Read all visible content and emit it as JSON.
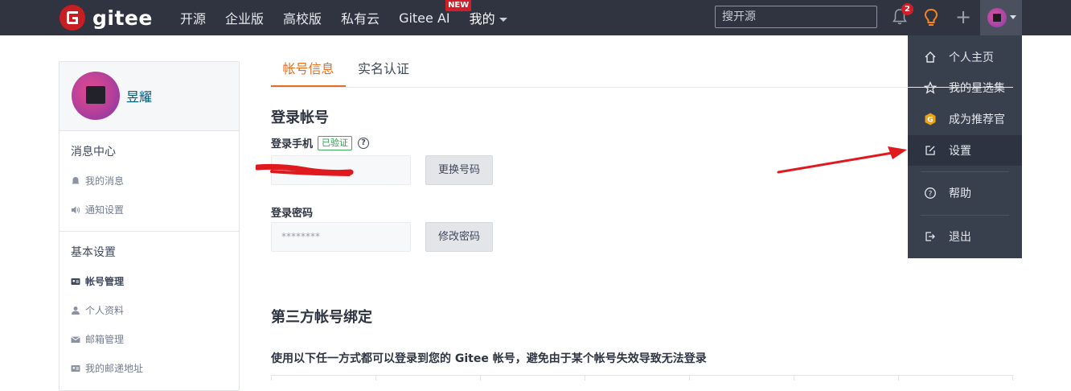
{
  "navbar": {
    "brand": "gitee",
    "items": [
      "开源",
      "企业版",
      "高校版",
      "私有云",
      "Gitee AI",
      "我的"
    ],
    "new_badge": "NEW",
    "search_placeholder": "搜开源",
    "notification_count": "2",
    "icons": [
      "bell-icon",
      "lightbulb-icon",
      "plus-icon",
      "avatar",
      "chevron-down-icon"
    ],
    "colors": {
      "bar": "#2f3440",
      "brand_red": "#c71d23",
      "badge_red": "#d31e2a",
      "bulb": "#f2871f"
    }
  },
  "user_menu": {
    "items": [
      {
        "label": "个人主页",
        "icon": "home-icon"
      },
      {
        "label": "我的星选集",
        "icon": "star-icon"
      },
      {
        "label": "成为推荐官",
        "icon": "gitee-badge-icon"
      },
      {
        "label": "设置",
        "icon": "edit-icon",
        "active": true
      },
      {
        "label": "帮助",
        "icon": "help-circle-icon"
      },
      {
        "label": "退出",
        "icon": "logout-icon"
      }
    ]
  },
  "sidebar": {
    "username": "昱耀",
    "sections": [
      {
        "title": "消息中心",
        "items": [
          {
            "label": "我的消息",
            "icon": "bell-icon"
          },
          {
            "label": "通知设置",
            "icon": "volume-icon"
          }
        ]
      },
      {
        "title": "基本设置",
        "items": [
          {
            "label": "帐号管理",
            "icon": "id-card-icon",
            "current": true
          },
          {
            "label": "个人资料",
            "icon": "user-icon"
          },
          {
            "label": "邮箱管理",
            "icon": "mail-icon"
          },
          {
            "label": "我的邮递地址",
            "icon": "address-card-icon"
          }
        ]
      }
    ]
  },
  "main": {
    "tabs": [
      "帐号信息",
      "实名认证"
    ],
    "login_account_title": "登录帐号",
    "phone_label": "登录手机",
    "verified_badge": "已验证",
    "change_phone_button": "更换号码",
    "password_label": "登录密码",
    "password_value": "********",
    "change_password_button": "修改密码",
    "third_party_title": "第三方帐号绑定",
    "third_party_desc": "使用以下任一方式都可以登录到您的 Gitee 帐号，避免由于某个帐号失效导致无法登录"
  }
}
